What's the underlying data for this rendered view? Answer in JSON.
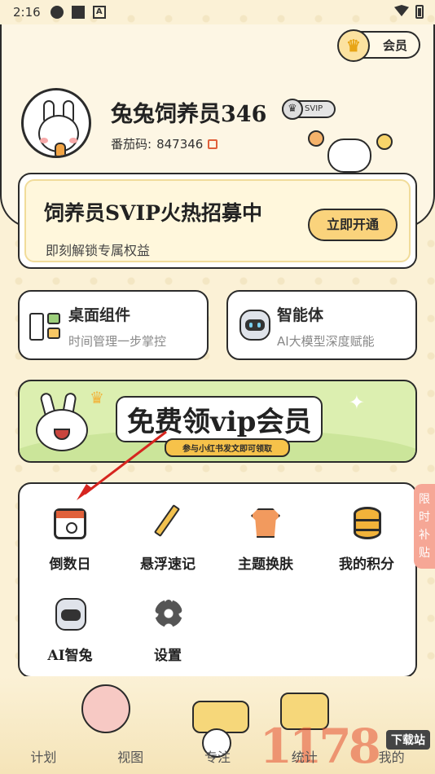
{
  "status_bar": {
    "time": "2:16",
    "a_label": "A"
  },
  "header": {
    "member_label": "会员",
    "username": "兔兔饲养员346",
    "svip_label": "SVIP",
    "id_label": "番茄码:",
    "id_value": "847346"
  },
  "svip_banner": {
    "title": "饲养员SVIP火热招募中",
    "subtitle": "即刻解锁专属权益",
    "button": "立即开通"
  },
  "features": [
    {
      "title": "桌面组件",
      "subtitle": "时间管理一步掌控"
    },
    {
      "title": "智能体",
      "subtitle": "AI大模型深度赋能"
    }
  ],
  "vip_banner": {
    "title": "免费领vip会员",
    "subtitle": "参与小红书发文即可领取"
  },
  "tools": [
    {
      "label": "倒数日",
      "icon": "calendar-clock-icon"
    },
    {
      "label": "悬浮速记",
      "icon": "pencil-icon"
    },
    {
      "label": "主题换肤",
      "icon": "tshirt-icon"
    },
    {
      "label": "我的积分",
      "icon": "coins-icon"
    },
    {
      "label": "AI智兔",
      "icon": "robot-icon"
    },
    {
      "label": "设置",
      "icon": "gear-icon"
    }
  ],
  "side_tab": {
    "label": "限时补贴"
  },
  "nav": [
    {
      "label": "计划"
    },
    {
      "label": "视图"
    },
    {
      "label": "专注"
    },
    {
      "label": "统计"
    },
    {
      "label": "我的"
    }
  ],
  "watermark": {
    "badge": "下载站",
    "logo": "1178"
  },
  "colors": {
    "background": "#fbf1d6",
    "accent_yellow": "#fad37c",
    "accent_orange": "#e0603a",
    "banner_green": "#dcefb0",
    "side_tab": "#f6a796",
    "arrow_red": "#d6251f"
  }
}
